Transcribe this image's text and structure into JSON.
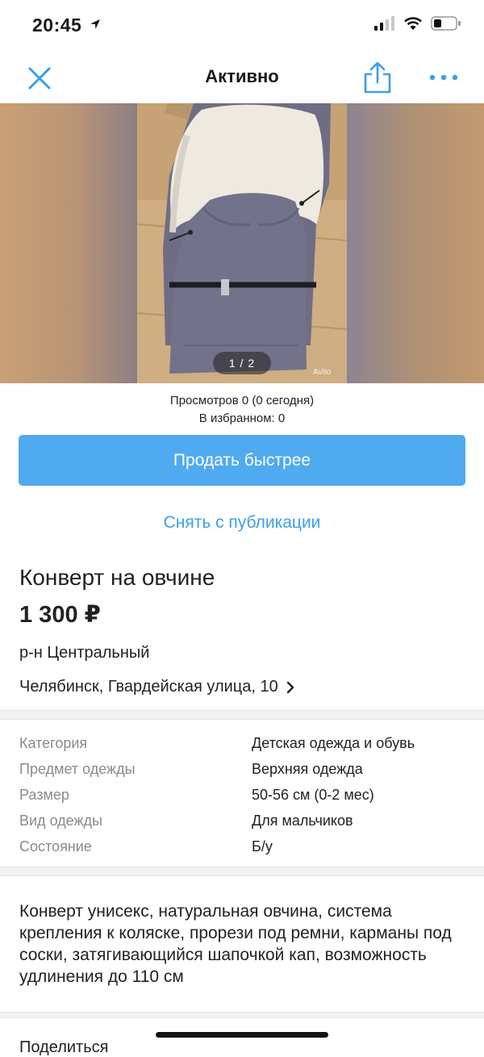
{
  "status_bar": {
    "time": "20:45"
  },
  "nav": {
    "title": "Активно"
  },
  "gallery": {
    "counter": "1 / 2",
    "watermark": "Avito"
  },
  "stats": {
    "views": "Просмотров 0 (0 сегодня)",
    "favorites": "В избранном: 0"
  },
  "actions": {
    "sell_faster": "Продать быстрее",
    "unpublish": "Снять с публикации"
  },
  "listing": {
    "title": "Конверт на овчине",
    "price": "1 300 ₽",
    "district": "р-н Центральный",
    "address": "Челябинск, Гвардейская улица, 10"
  },
  "params": [
    {
      "label": "Категория",
      "value": "Детская одежда и обувь"
    },
    {
      "label": "Предмет одежды",
      "value": "Верхняя одежда"
    },
    {
      "label": "Размер",
      "value": "50-56 см (0-2 мес)"
    },
    {
      "label": "Вид одежды",
      "value": "Для мальчиков"
    },
    {
      "label": "Состояние",
      "value": "Б/у"
    }
  ],
  "description": "Конверт унисекс, натуральная овчина, система крепления к коляске, прорези под ремни, карманы под соски, затягивающийся шапочкой кап, возможность удлинения до 110 см",
  "share": {
    "label": "Поделиться"
  },
  "colors": {
    "accent": "#4faaf0",
    "link": "#3a9fe8"
  }
}
